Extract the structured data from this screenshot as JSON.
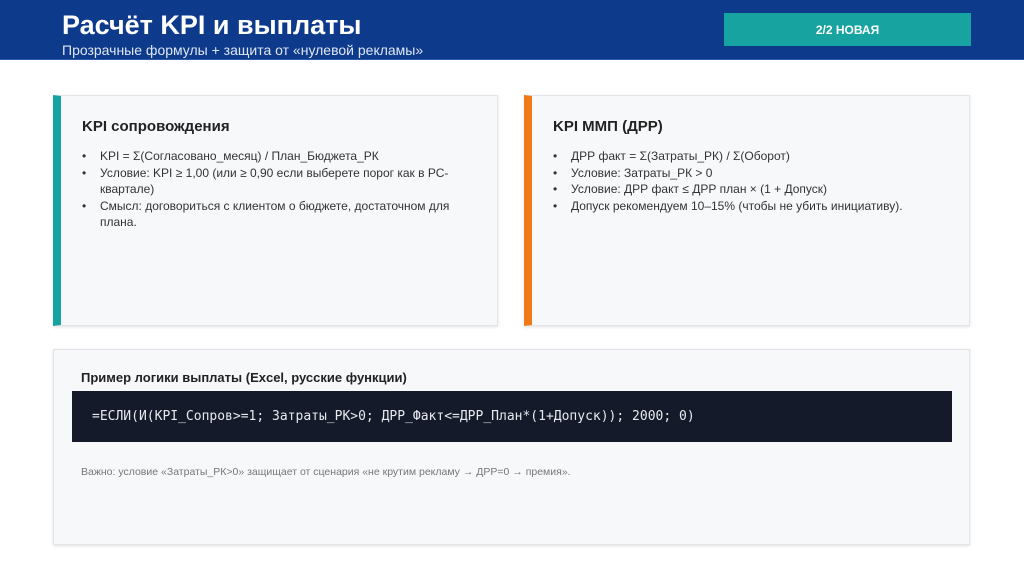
{
  "header": {
    "title": "Расчёт KPI и выплаты",
    "subtitle": "Прозрачные формулы + защита от «нулевой рекламы»",
    "badge": "2/2 НОВАЯ"
  },
  "cards": [
    {
      "title": "KPI сопровождения",
      "accent": "#17a3a0",
      "items": [
        "KPI = Σ(Согласовано_месяц) / План_Бюджета_РК",
        "Условие: KPI ≥ 1,00 (или ≥ 0,90 если выберете порог как в РС-квартале)",
        "Смысл: договориться с клиентом о бюджете, достаточном для плана."
      ]
    },
    {
      "title": "KPI ММП (ДРР)",
      "accent": "#f07a1a",
      "items": [
        "ДРР факт = Σ(Затраты_РК) / Σ(Оборот)",
        "Условие: Затраты_РК > 0",
        "Условие: ДРР факт ≤ ДРР план × (1 + Допуск)",
        "Допуск рекомендуем 10–15% (чтобы не убить инициативу)."
      ]
    }
  ],
  "example": {
    "title": "Пример логики выплаты (Excel, русские функции)",
    "code": "=ЕСЛИ(И(KPI_Сопров>=1; Затраты_РК>0; ДРР_Факт<=ДРР_План*(1+Допуск)); 2000; 0)",
    "note": "Важно: условие «Затраты_РК>0» защищает от сценария «не крутим рекламу → ДРР=0 → премия»."
  }
}
